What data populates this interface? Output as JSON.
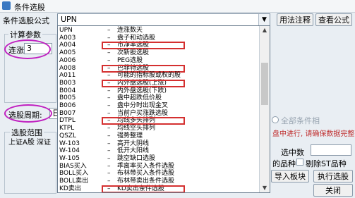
{
  "window": {
    "title": "条件选股"
  },
  "formula_label": "条件选股公式",
  "formula_combo": {
    "value": "UPN"
  },
  "dropdown_items": [
    {
      "code": "UPN",
      "desc": "连涨数天"
    },
    {
      "code": "A003",
      "desc": "盘子和动选股"
    },
    {
      "code": "A004",
      "desc": "市净率选股",
      "highlight": true
    },
    {
      "code": "A005",
      "desc": "次新股选股"
    },
    {
      "code": "A006",
      "desc": "PEG选股"
    },
    {
      "code": "A008",
      "desc": "巴菲特选股",
      "highlight": true
    },
    {
      "code": "A011",
      "desc": "可能的指标股或权的股"
    },
    {
      "code": "B003",
      "desc": "内外盘选股(上涨)",
      "highlight": true
    },
    {
      "code": "B004",
      "desc": "内外盘选股(下跌)"
    },
    {
      "code": "B005",
      "desc": "盘中超跌低价股"
    },
    {
      "code": "B006",
      "desc": "盘中分时出现金叉"
    },
    {
      "code": "B007",
      "desc": "当前户买涨跌选股"
    },
    {
      "code": "DTPL",
      "desc": "均线多头排列",
      "highlight": true
    },
    {
      "code": "KTPL",
      "desc": "均线空头排列"
    },
    {
      "code": "QSZL",
      "desc": "强势整理"
    },
    {
      "code": "W-103",
      "desc": "高开大阴线"
    },
    {
      "code": "W-104",
      "desc": "低开大阳线"
    },
    {
      "code": "W-105",
      "desc": "跳空缺口选股"
    },
    {
      "code": "BIAS买入",
      "desc": "乖离率买入条件选股"
    },
    {
      "code": "BOLL买入",
      "desc": "布林带买入条件选股"
    },
    {
      "code": "BOLL卖出",
      "desc": "布林带卖出条件选股"
    },
    {
      "code": "KD卖出",
      "desc": "KD卖出条件选股",
      "highlight": true
    }
  ],
  "calc_params": {
    "group_title": "计算参数",
    "param_label": "连涨",
    "param_value": "3"
  },
  "period": {
    "label": "选股周期:",
    "value": "日"
  },
  "range": {
    "group_title": "选股范围",
    "market_text": "上证A股 深证"
  },
  "right_panel": {
    "usage_button": "用法注释",
    "view_button": "查看公式",
    "all_condition": "全部条件相",
    "status_text": "盘中进行, 请确保数据完整",
    "selected_count_label": "选中数",
    "varieties_text": "的品种",
    "exclude_st": "剔除ST品种",
    "import_button": "导入板块",
    "execute_button": "执行选股",
    "close_button": "关闭"
  },
  "colors": {
    "highlight_box": "#d43030",
    "annotation_oval": "#c020c0",
    "status_text": "#c03030"
  }
}
